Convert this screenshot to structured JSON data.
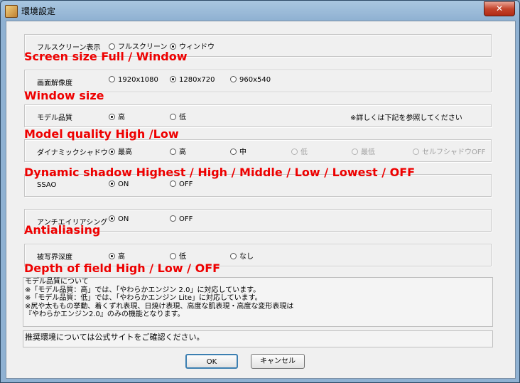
{
  "window": {
    "title": "環境設定",
    "close_glyph": "✕"
  },
  "rows": [
    {
      "label": "フルスクリーン表示",
      "options": [
        {
          "text": "フルスクリーン",
          "checked": false,
          "disabled": false
        },
        {
          "text": "ウィンドウ",
          "checked": true,
          "disabled": false
        }
      ]
    },
    {
      "label": "画面解像度",
      "options": [
        {
          "text": "1920x1080",
          "checked": false,
          "disabled": false
        },
        {
          "text": "1280x720",
          "checked": true,
          "disabled": false
        },
        {
          "text": "960x540",
          "checked": false,
          "disabled": false
        }
      ]
    },
    {
      "label": "モデル品質",
      "options": [
        {
          "text": "高",
          "checked": true,
          "disabled": false
        },
        {
          "text": "低",
          "checked": false,
          "disabled": false
        }
      ],
      "note": "※詳しくは下記を参照してください"
    },
    {
      "label": "ダイナミックシャドウ",
      "options": [
        {
          "text": "最高",
          "checked": true,
          "disabled": false
        },
        {
          "text": "高",
          "checked": false,
          "disabled": false
        },
        {
          "text": "中",
          "checked": false,
          "disabled": false
        },
        {
          "text": "低",
          "checked": false,
          "disabled": true
        },
        {
          "text": "最低",
          "checked": false,
          "disabled": true
        },
        {
          "text": "セルフシャドウOFF",
          "checked": false,
          "disabled": true
        }
      ]
    },
    {
      "label": "SSAO",
      "options": [
        {
          "text": "ON",
          "checked": true,
          "disabled": false
        },
        {
          "text": "OFF",
          "checked": false,
          "disabled": false
        }
      ]
    },
    {
      "label": "アンチエイリアシング",
      "options": [
        {
          "text": "ON",
          "checked": true,
          "disabled": false
        },
        {
          "text": "OFF",
          "checked": false,
          "disabled": false
        }
      ]
    },
    {
      "label": "被写界深度",
      "options": [
        {
          "text": "高",
          "checked": true,
          "disabled": false
        },
        {
          "text": "低",
          "checked": false,
          "disabled": false
        },
        {
          "text": "なし",
          "checked": false,
          "disabled": false
        }
      ]
    }
  ],
  "annotations": [
    "Screen size     Full / Window",
    "Window size",
    "Model quality High /Low",
    "Dynamic shadow  Highest / High / Middle / Low / Lowest / OFF",
    "Antialiasing",
    "Depth of field High / Low / OFF"
  ],
  "info_lines": [
    "モデル品質について",
    "※「モデル品質：高」では、「やわらかエンジン 2.0」に対応しています。",
    "※「モデル品質：低」では、「やわらかエンジン Lite」に対応しています。",
    "※尻や太ももの挙動、着くずれ表現、日焼け表現、高度な肌表現・高度な変形表現は",
    "『やわらかエンジン2.0』のみの機能となります。"
  ],
  "recommend_text": "推奨環境については公式サイトをご確認ください。",
  "buttons": {
    "ok": "OK",
    "cancel": "キャンセル"
  }
}
